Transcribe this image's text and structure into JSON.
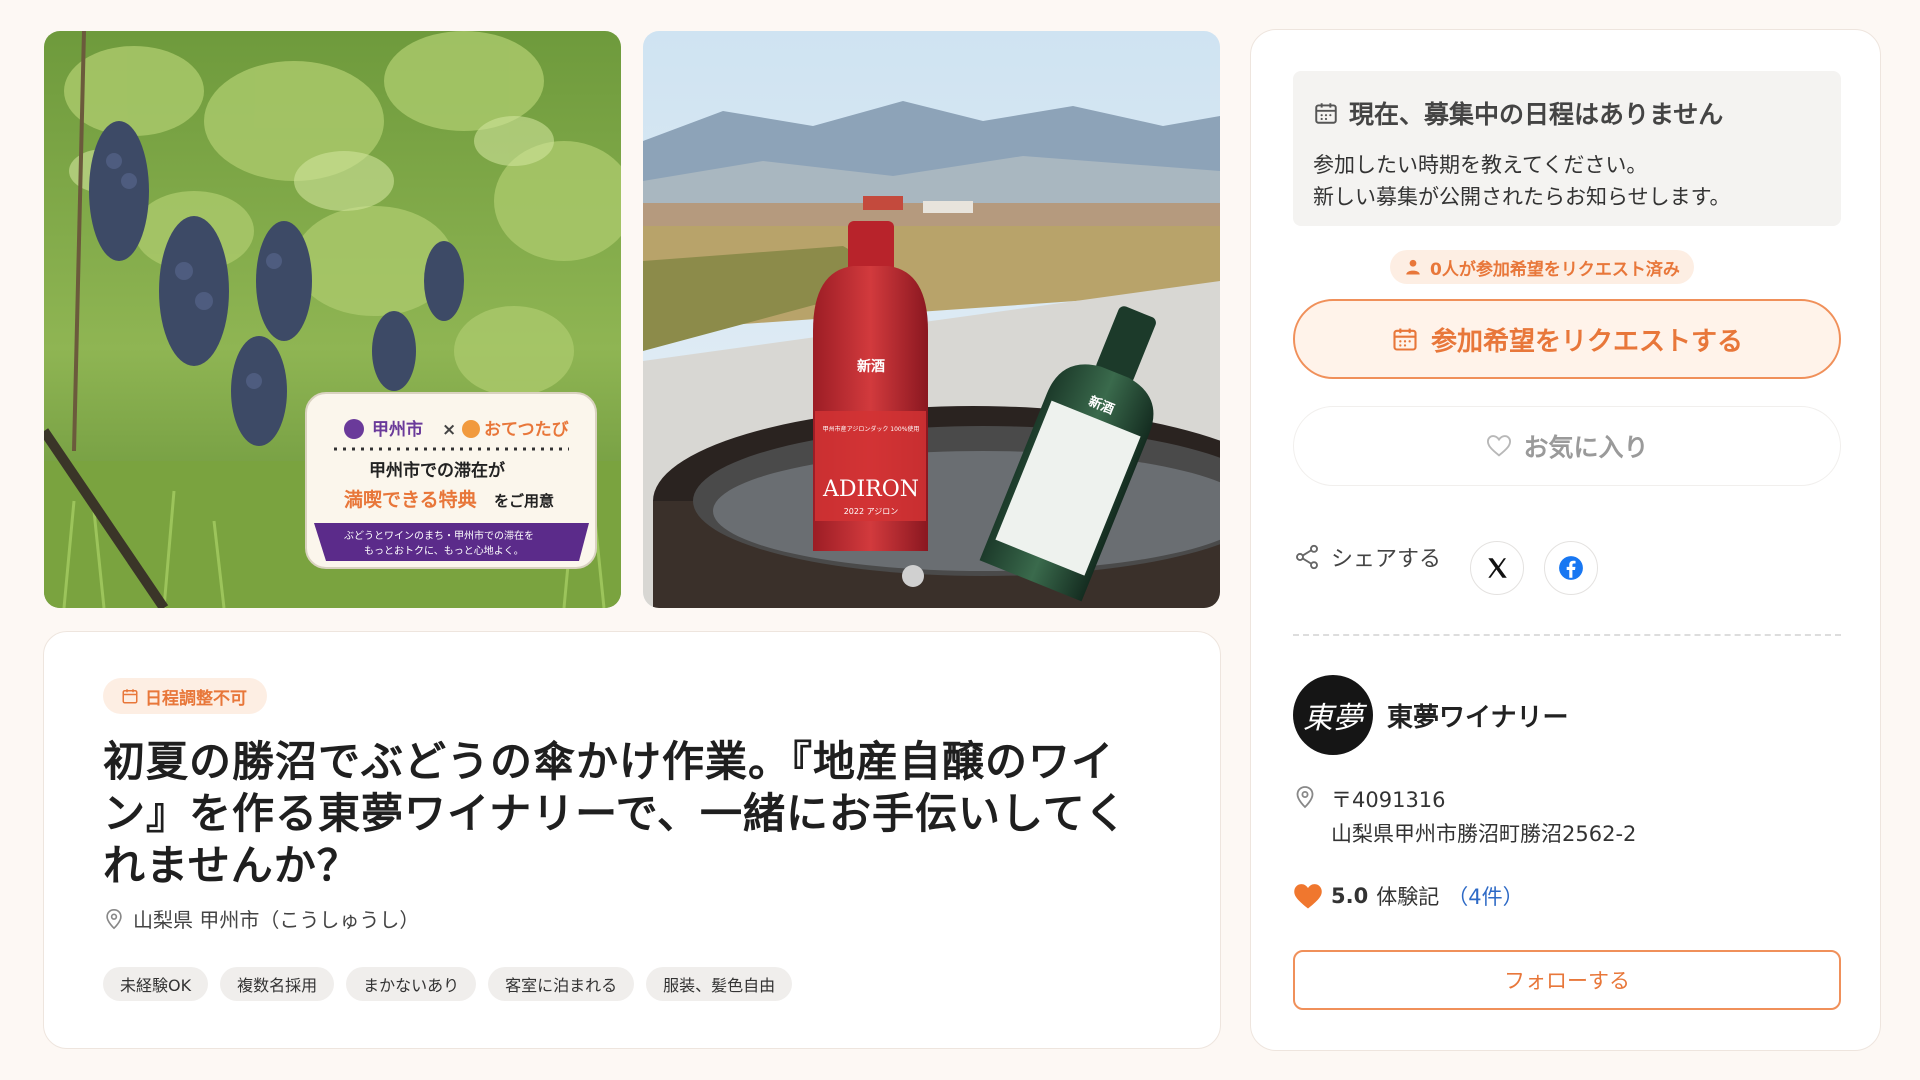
{
  "gallery": {
    "photo1_badge": {
      "city": "甲州市",
      "cross": "×",
      "brand": "おてつたび",
      "line1": "甲州市での滞在が",
      "line2_highlight": "満喫できる特典",
      "line2_rest": "をご用意",
      "banner_line1": "ぶどうとワインのまち・甲州市での滞在を",
      "banner_line2": "もっとおトクに、もっと心地よく。"
    },
    "photo2_labels": {
      "bottle_red_cap_label": "新酒",
      "bottle_red_brand": "ADIRON",
      "bottle_red_small": "甲州市産アジロンダック 100%使用",
      "bottle_red_year": "2022 アジロン",
      "bottle_white_cap_label": "新酒"
    }
  },
  "main": {
    "schedule_tag": "日程調整不可",
    "title": "初夏の勝沼でぶどうの傘かけ作業。『地産自醸のワイン』を作る東夢ワイナリーで、一緒にお手伝いしてくれませんか？",
    "location": "山梨県 甲州市（こうしゅうし）",
    "chips": [
      "未経験OK",
      "複数名採用",
      "まかないあり",
      "客室に泊まれる",
      "服装、髪色自由"
    ]
  },
  "side": {
    "notice_title": "現在、募集中の日程はありません",
    "notice_line1": "参加したい時期を教えてください。",
    "notice_line2": "新しい募集が公開されたらお知らせします。",
    "request_count": "0人が参加希望をリクエスト済み",
    "request_button": "参加希望をリクエストする",
    "favorite_button": "お気に入り",
    "share_label": "シェアする",
    "org_avatar_text": "東夢",
    "org_name": "東夢ワイナリー",
    "postal": "〒4091316",
    "address": "山梨県甲州市勝沼町勝沼2562-2",
    "rating_score": "5.0",
    "rating_label": "体験記",
    "rating_count": "（4件）",
    "follow_button": "フォローする"
  },
  "colors": {
    "accent": "#e8773a",
    "accent_bg": "#fdeee3",
    "link": "#2e6ac6",
    "page_bg": "#fdf8f4"
  },
  "icons": [
    "calendar-icon",
    "person-icon",
    "heart-outline-icon",
    "share-icon",
    "x-logo-icon",
    "facebook-icon",
    "map-pin-icon",
    "heart-filled-icon"
  ]
}
